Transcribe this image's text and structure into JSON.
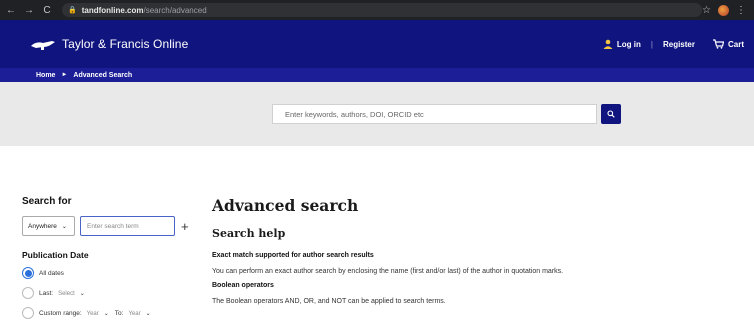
{
  "browser": {
    "back": "←",
    "forward": "→",
    "reload": "C",
    "url_host": "tandfonline.com",
    "url_path": "/search/advanced",
    "star": "☆",
    "kebab": "⋮"
  },
  "header": {
    "logo_text": "Taylor & Francis Online",
    "login_label": "Log in",
    "separator": "|",
    "register_label": "Register",
    "cart_label": "Cart",
    "bg_color": "#10147e"
  },
  "breadcrumb": {
    "home": "Home",
    "arrow": "►",
    "current": "Advanced Search"
  },
  "search": {
    "placeholder": "Enter keywords, authors, DOI, ORCID etc"
  },
  "sidebar": {
    "search_for_title": "Search for",
    "field_select": "Anywhere",
    "term_placeholder": "Enter search term",
    "add_label": "+",
    "pub_date_title": "Publication Date",
    "all_dates_label": "All dates",
    "last_label": "Last:",
    "last_select": "Select",
    "custom_range_label": "Custom range:",
    "from_select": "Year",
    "to_label": "To:",
    "to_select": "Year",
    "accent_color": "#2a6fdb"
  },
  "main": {
    "title": "Advanced search",
    "help_title": "Search help",
    "exact_heading": "Exact match supported for author search results",
    "exact_text": "You can perform an exact author search by enclosing the name (first and/or last) of the author in quotation marks.",
    "boolean_heading": "Boolean operators",
    "boolean_text": "The Boolean operators AND, OR, and NOT can be applied to search terms."
  }
}
